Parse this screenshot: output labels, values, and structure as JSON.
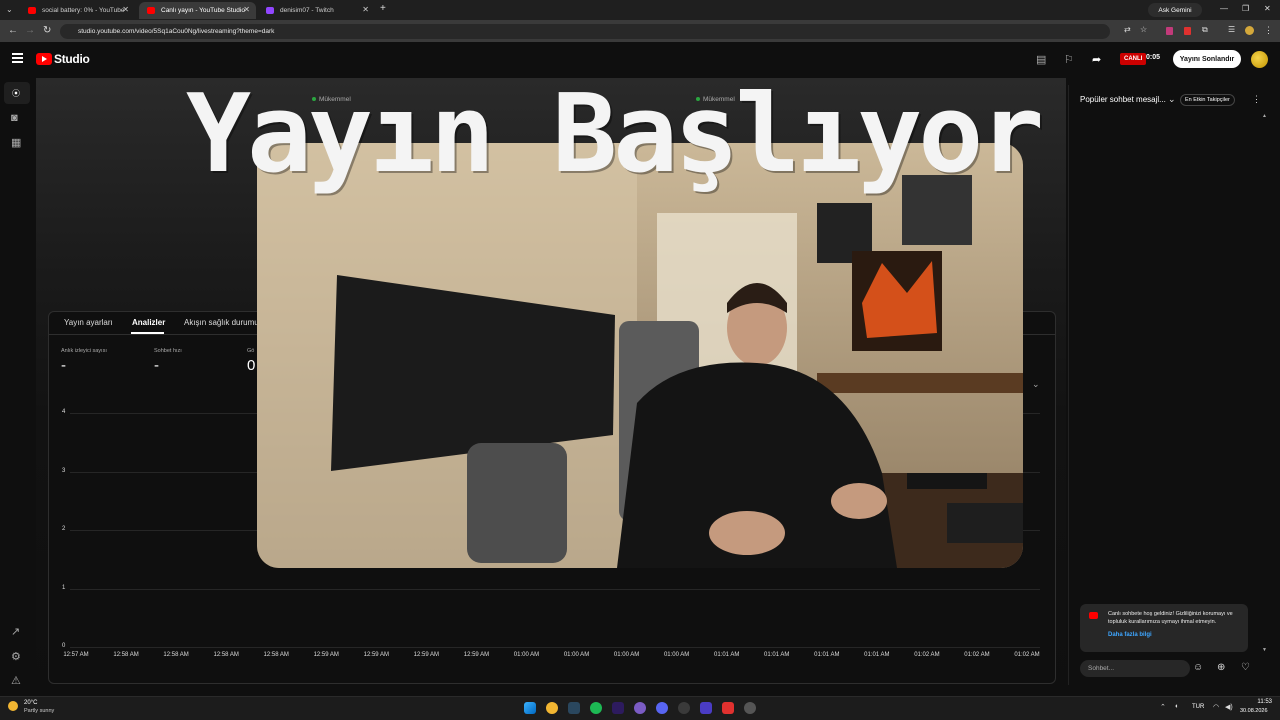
{
  "browser": {
    "tabs": [
      {
        "label": "social battery: 0% - YouTube",
        "favicon_color": "#ff0000"
      },
      {
        "label": "Canlı yayın - YouTube Studio",
        "favicon_color": "#ff0000"
      },
      {
        "label": "denisim07 - Twitch",
        "favicon_color": "#9146ff"
      }
    ],
    "url": "studio.youtube.com/video/5Sq1aCou0Ng/livestreaming?theme=dark",
    "gemini_label": "Ask Gemini"
  },
  "studio": {
    "logo_text": "Studio",
    "live_badge": "CANLI",
    "timer": "0:05",
    "end_stream_label": "Yayını Sonlandır",
    "status_left": "Mükemmel",
    "status_right": "Mükemmel",
    "tabs": [
      "Yayın ayarları",
      "Analizler",
      "Akışın sağlık durumu"
    ],
    "active_tab": "Analizler",
    "metrics": [
      {
        "label": "Anlık izleyici sayısı",
        "value": "-"
      },
      {
        "label": "Sohbet hızı",
        "value": "-"
      },
      {
        "label": "Gö",
        "value": "0"
      }
    ]
  },
  "chart_data": {
    "type": "line",
    "title": "",
    "xlabel": "",
    "ylabel": "",
    "yticks": [
      "0",
      "1",
      "2",
      "3",
      "4"
    ],
    "ylim": [
      0,
      4
    ],
    "x": [
      "12:57 AM",
      "12:58 AM",
      "12:58 AM",
      "12:58 AM",
      "12:58 AM",
      "12:59 AM",
      "12:59 AM",
      "12:59 AM",
      "12:59 AM",
      "01:00 AM",
      "01:00 AM",
      "01:00 AM",
      "01:00 AM",
      "01:01 AM",
      "01:01 AM",
      "01:01 AM",
      "01:01 AM",
      "01:02 AM",
      "01:02 AM",
      "01:02 AM"
    ],
    "series": [],
    "grid": true
  },
  "chat": {
    "title": "Popüler sohbet mesajl...",
    "top_fans_label": "En Etkin Takipçiler",
    "welcome_text": "Canlı sohbete hoş geldiniz! Gizliliğinizi korumayı ve topluluk kurallarımıza uymayı ihmal etmeyin.",
    "learn_more": "Daha fazla bilgi",
    "input_placeholder": "Sohbet..."
  },
  "overlay": {
    "title": "Yayın Başlıyor",
    "dots_count": 3
  },
  "taskbar": {
    "temperature": "20°C",
    "weather": "Partly sunny",
    "language": "TUR",
    "time": "11:53",
    "date": "30.08.2026"
  }
}
